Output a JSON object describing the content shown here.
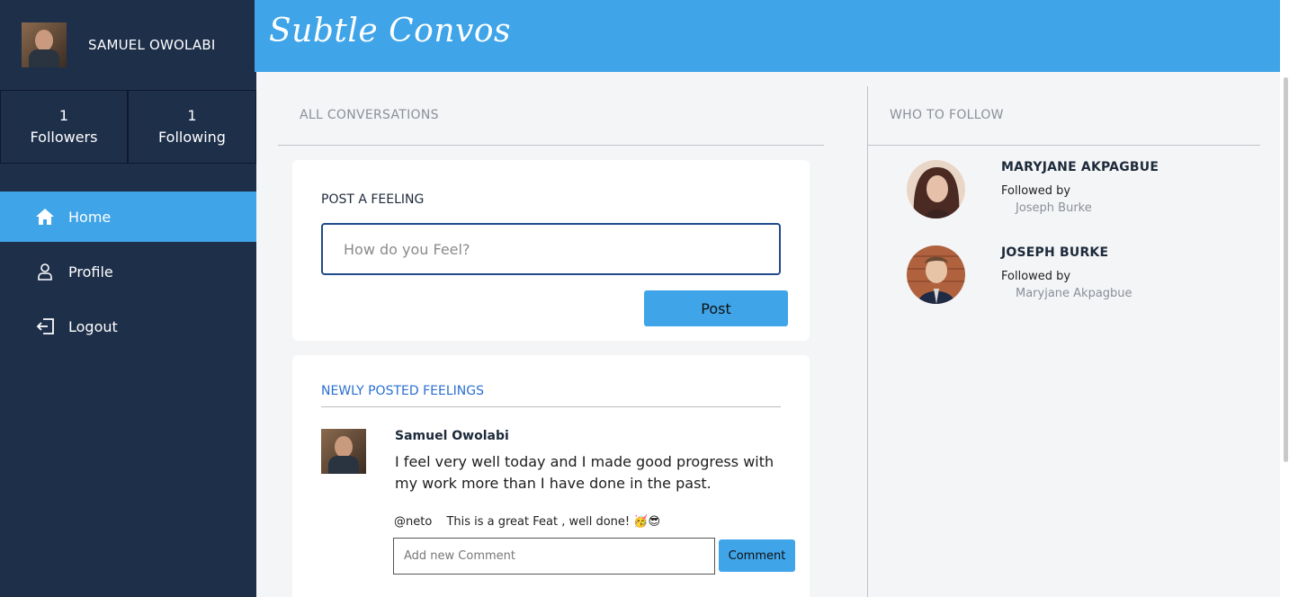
{
  "app": {
    "brand": "Subtle Convos"
  },
  "user": {
    "name": "SAMUEL OWOLABI"
  },
  "stats": [
    {
      "count": "1",
      "label": "Followers"
    },
    {
      "count": "1",
      "label": "Following"
    }
  ],
  "nav": [
    {
      "label": "Home",
      "icon": "home-icon",
      "active": true
    },
    {
      "label": "Profile",
      "icon": "user-icon",
      "active": false
    },
    {
      "label": "Logout",
      "icon": "logout-icon",
      "active": false
    }
  ],
  "main": {
    "section_title": "ALL CONVERSATIONS",
    "composer": {
      "label": "POST A FEELING",
      "placeholder": "How do you Feel?",
      "value": "",
      "button": "Post"
    },
    "feed": {
      "title": "NEWLY POSTED FEELINGS",
      "post": {
        "author": "Samuel Owolabi",
        "text": "I feel very well today and I made good progress with my work more than I have done in the past.",
        "comment": {
          "handle": "@neto",
          "text": "This is a great Feat , well done! 🥳😎"
        },
        "comment_placeholder": "Add new Comment",
        "comment_button": "Comment"
      }
    }
  },
  "right": {
    "section_title": "WHO TO FOLLOW",
    "suggestions": [
      {
        "name": "MARYJANE AKPAGBUE",
        "followed_by_label": "Followed by",
        "followed_by": "Joseph Burke"
      },
      {
        "name": "JOSEPH BURKE",
        "followed_by_label": "Followed by",
        "followed_by": "Maryjane Akpagbue"
      }
    ]
  },
  "colors": {
    "sidebar": "#1e2f4a",
    "accent": "#3fa4e8",
    "link": "#2a6fd1"
  }
}
